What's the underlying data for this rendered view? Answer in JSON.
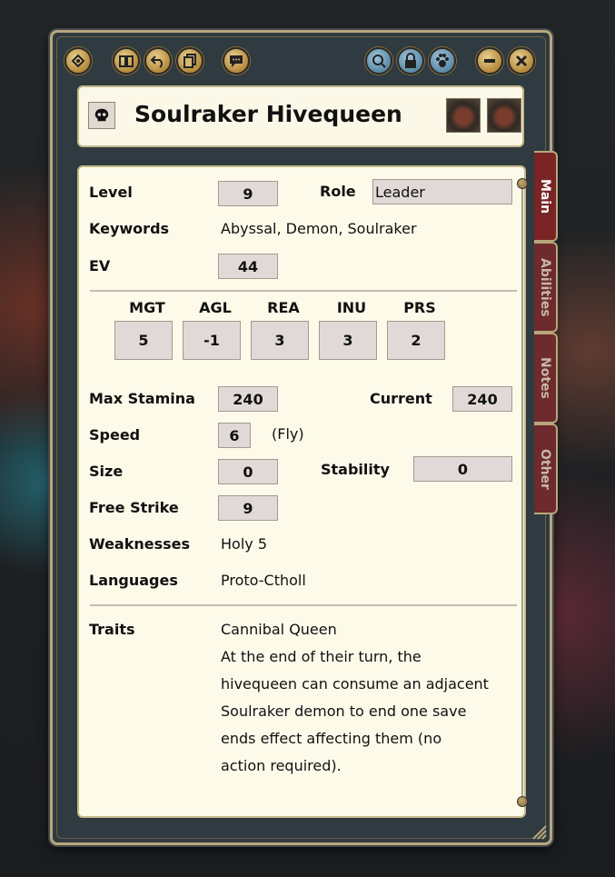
{
  "window": {
    "title": "Soulraker Hivequeen",
    "toolbar_icons": [
      "faction-icon",
      "journal-icon",
      "undo-icon",
      "copy-icon",
      "chat-icon",
      "search-icon",
      "lock-icon",
      "paw-icon",
      "minimize-icon",
      "close-icon"
    ]
  },
  "stats": {
    "level_label": "Level",
    "level": "9",
    "role_label": "Role",
    "role": "Leader",
    "keywords_label": "Keywords",
    "keywords": "Abyssal, Demon, Soulraker",
    "ev_label": "EV",
    "ev": "44"
  },
  "characteristics": [
    {
      "label": "MGT",
      "value": "5"
    },
    {
      "label": "AGL",
      "value": "-1"
    },
    {
      "label": "REA",
      "value": "3"
    },
    {
      "label": "INU",
      "value": "3"
    },
    {
      "label": "PRS",
      "value": "2"
    }
  ],
  "combat": {
    "max_stamina_label": "Max Stamina",
    "max_stamina": "240",
    "current_label": "Current",
    "current": "240",
    "speed_label": "Speed",
    "speed": "6",
    "speed_note": "(Fly)",
    "size_label": "Size",
    "size": "0",
    "stability_label": "Stability",
    "stability": "0",
    "free_strike_label": "Free Strike",
    "free_strike": "9",
    "weaknesses_label": "Weaknesses",
    "weaknesses": "Holy 5",
    "languages_label": "Languages",
    "languages": "Proto-Ctholl"
  },
  "traits": {
    "label": "Traits",
    "name": "Cannibal Queen",
    "lines": [
      "At the end of their turn, the",
      "hivequeen can consume an adjacent",
      "Soulraker demon to end one save",
      "ends effect affecting them (no",
      "action required)."
    ]
  },
  "tabs": [
    {
      "label": "Main",
      "active": true
    },
    {
      "label": "Abilities",
      "active": false
    },
    {
      "label": "Notes",
      "active": false
    },
    {
      "label": "Other",
      "active": false
    }
  ],
  "colors": {
    "accent": "#7a2425",
    "gold": "#b8a77c",
    "parchment": "#fdfaea"
  }
}
